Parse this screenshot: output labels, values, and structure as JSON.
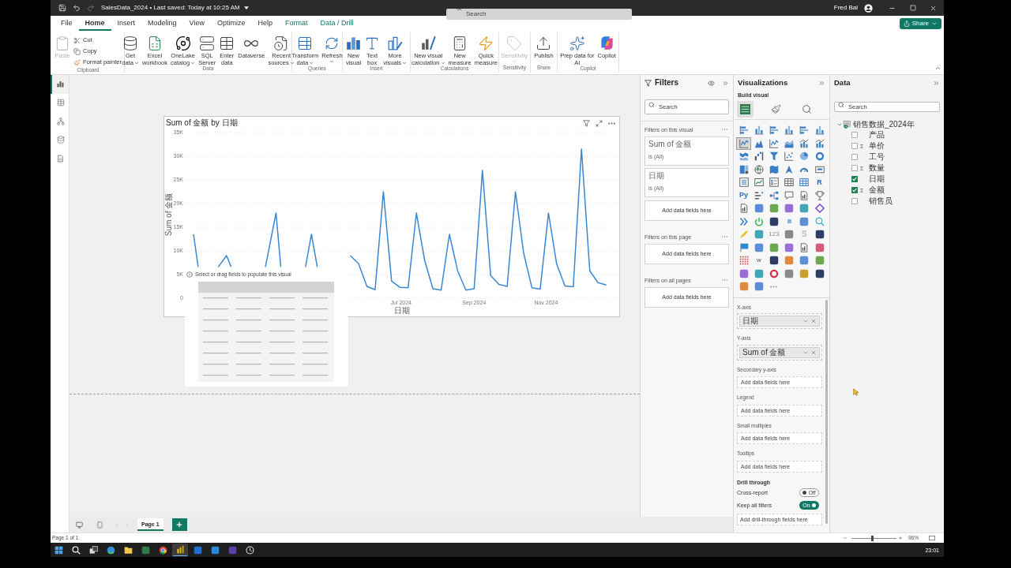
{
  "title_bar": {
    "document_title": "SalesData_2024 • Last saved: Today at 10:25 AM",
    "search": {
      "placeholder": "Search"
    },
    "user_name": "Fred Bai"
  },
  "ribbon_tabs": [
    {
      "label": "File",
      "selected": false,
      "contextual": false
    },
    {
      "label": "Home",
      "selected": true,
      "contextual": false
    },
    {
      "label": "Insert",
      "selected": false,
      "contextual": false
    },
    {
      "label": "Modeling",
      "selected": false,
      "contextual": false
    },
    {
      "label": "View",
      "selected": false,
      "contextual": false
    },
    {
      "label": "Optimize",
      "selected": false,
      "contextual": false
    },
    {
      "label": "Help",
      "selected": false,
      "contextual": false
    },
    {
      "label": "Format",
      "selected": false,
      "contextual": true
    },
    {
      "label": "Data / Drill",
      "selected": false,
      "contextual": true
    }
  ],
  "share_button": {
    "label": "Share"
  },
  "ribbon_groups": [
    {
      "label": "Clipboard",
      "buttons": [
        {
          "kind": "large",
          "lines": [
            "Paste"
          ],
          "dropdown": false,
          "disabled": true
        },
        {
          "kind": "small",
          "lines": [
            "Cut"
          ],
          "dropdown": false,
          "disabled": false
        },
        {
          "kind": "small",
          "lines": [
            "Copy"
          ],
          "dropdown": false,
          "disabled": false
        },
        {
          "kind": "small",
          "lines": [
            "Format painter"
          ],
          "dropdown": false,
          "disabled": false
        }
      ]
    },
    {
      "label": "Data",
      "buttons": [
        {
          "kind": "large",
          "lines": [
            "Get",
            "data"
          ],
          "dropdown": true,
          "disabled": false
        },
        {
          "kind": "large",
          "lines": [
            "Excel",
            "workbook"
          ],
          "dropdown": false,
          "disabled": false
        },
        {
          "kind": "large",
          "lines": [
            "OneLake",
            "catalog"
          ],
          "dropdown": true,
          "disabled": false
        },
        {
          "kind": "large",
          "lines": [
            "SQL",
            "Server"
          ],
          "dropdown": false,
          "disabled": false
        },
        {
          "kind": "large",
          "lines": [
            "Enter",
            "data"
          ],
          "dropdown": false,
          "disabled": false
        },
        {
          "kind": "large",
          "lines": [
            "Dataverse"
          ],
          "dropdown": false,
          "disabled": false
        },
        {
          "kind": "large",
          "lines": [
            "Recent",
            "sources"
          ],
          "dropdown": true,
          "disabled": false
        }
      ]
    },
    {
      "label": "Queries",
      "buttons": [
        {
          "kind": "large",
          "lines": [
            "Transform",
            "data"
          ],
          "dropdown": true,
          "disabled": false
        },
        {
          "kind": "large",
          "lines": [
            "Refresh"
          ],
          "dropdown": true,
          "disabled": false
        }
      ]
    },
    {
      "label": "Insert",
      "buttons": [
        {
          "kind": "large",
          "lines": [
            "New",
            "visual"
          ],
          "dropdown": false,
          "disabled": false
        },
        {
          "kind": "large",
          "lines": [
            "Text",
            "box"
          ],
          "dropdown": false,
          "disabled": false
        },
        {
          "kind": "large",
          "lines": [
            "More",
            "visuals"
          ],
          "dropdown": true,
          "disabled": false
        }
      ]
    },
    {
      "label": "Calculations",
      "buttons": [
        {
          "kind": "large",
          "lines": [
            "New visual",
            "calculation"
          ],
          "dropdown": true,
          "disabled": false
        },
        {
          "kind": "large",
          "lines": [
            "New",
            "measure"
          ],
          "dropdown": false,
          "disabled": false
        },
        {
          "kind": "large",
          "lines": [
            "Quick",
            "measure"
          ],
          "dropdown": false,
          "disabled": false
        }
      ]
    },
    {
      "label": "Sensitivity",
      "buttons": [
        {
          "kind": "large",
          "lines": [
            "Sensitivity"
          ],
          "dropdown": true,
          "disabled": true
        }
      ]
    },
    {
      "label": "Share",
      "buttons": [
        {
          "kind": "large",
          "lines": [
            "Publish"
          ],
          "dropdown": false,
          "disabled": false
        }
      ]
    },
    {
      "label": "Copilot",
      "buttons": [
        {
          "kind": "large",
          "lines": [
            "Prep data for",
            "AI"
          ],
          "dropdown": false,
          "disabled": false
        },
        {
          "kind": "large",
          "lines": [
            "Copilot"
          ],
          "dropdown": false,
          "disabled": false
        }
      ]
    }
  ],
  "view_switcher": [
    {
      "selected": true
    },
    {
      "selected": false
    },
    {
      "selected": false
    },
    {
      "selected": false
    },
    {
      "selected": false
    }
  ],
  "report_canvas": {
    "visual": {
      "chart_data": [
        {
          "type": "line",
          "title": "Sum of 金额 by 日期",
          "xlabel": "日期",
          "ylabel": "Sum of 金额",
          "color": "#3a87d4",
          "grid": true,
          "xlim": [
            "2024-01-01",
            "2024-12-31"
          ],
          "ylim": [
            0,
            35000
          ],
          "xticks": [
            {
              "value": "2024-07-01",
              "label": "Jul 2024"
            },
            {
              "value": "2024-09-01",
              "label": "Sep 2024"
            },
            {
              "value": "2024-11-01",
              "label": "Nov 2024"
            }
          ],
          "yticks": [
            {
              "value": 0,
              "label": "0"
            },
            {
              "value": 5000,
              "label": "5K"
            },
            {
              "value": 10000,
              "label": "10K"
            },
            {
              "value": 15000,
              "label": "15K"
            },
            {
              "value": 20000,
              "label": "20K"
            },
            {
              "value": 25000,
              "label": "25K"
            },
            {
              "value": 30000,
              "label": "30K"
            },
            {
              "value": 35000,
              "label": "35K"
            }
          ],
          "x": [
            "2024-01-07",
            "2024-01-11",
            "2024-01-21",
            "2024-01-28",
            "2024-02-04",
            "2024-02-08",
            "2024-02-25",
            "2024-03-08",
            "2024-03-17",
            "2024-03-21",
            "2024-04-01",
            "2024-04-11",
            "2024-04-16",
            "2024-04-21",
            "2024-05-05",
            "2024-05-19",
            "2024-05-26",
            "2024-06-02",
            "2024-06-09",
            "2024-06-16",
            "2024-06-23",
            "2024-06-30",
            "2024-07-07",
            "2024-07-14",
            "2024-07-21",
            "2024-07-28",
            "2024-08-04",
            "2024-08-11",
            "2024-08-18",
            "2024-08-25",
            "2024-09-01",
            "2024-09-08",
            "2024-09-15",
            "2024-09-22",
            "2024-09-29",
            "2024-10-06",
            "2024-10-13",
            "2024-10-20",
            "2024-10-27",
            "2024-11-03",
            "2024-11-10",
            "2024-11-17",
            "2024-11-24",
            "2024-12-01",
            "2024-12-08",
            "2024-12-15",
            "2024-12-22"
          ],
          "values": [
            13500,
            6600,
            null,
            6600,
            9000,
            6600,
            null,
            6600,
            18000,
            6600,
            null,
            6600,
            13500,
            6600,
            null,
            9000,
            7300,
            2500,
            1800,
            22500,
            3600,
            2300,
            2200,
            18000,
            8000,
            2000,
            1700,
            13500,
            5800,
            1700,
            2000,
            27000,
            4800,
            2900,
            2500,
            22500,
            9500,
            2200,
            1900,
            18000,
            7200,
            2600,
            2400,
            31500,
            5800,
            3300,
            2800
          ]
        }
      ]
    },
    "placeholder_visual": {
      "message": "Select or drag fields to populate this visual"
    }
  },
  "page_tabs": [
    {
      "label": "Page 1",
      "selected": true
    }
  ],
  "filters_pane": {
    "title": "Filters",
    "search": {
      "placeholder": "Search"
    },
    "sections": [
      {
        "title": "Filters on this visual",
        "cards": [
          {
            "kind": "filter",
            "field": "Sum of 金额",
            "condition": "is (All)"
          },
          {
            "kind": "filter",
            "field": "日期",
            "condition": "is (All)"
          },
          {
            "kind": "drop",
            "placeholder": "Add data fields here"
          }
        ]
      },
      {
        "title": "Filters on this page",
        "cards": [
          {
            "kind": "drop",
            "placeholder": "Add data fields here"
          }
        ]
      },
      {
        "title": "Filters on all pages",
        "cards": [
          {
            "kind": "drop",
            "placeholder": "Add data fields here"
          }
        ]
      }
    ]
  },
  "visualizations_pane": {
    "title": "Visualizations",
    "subtitle": "Build visual",
    "build_tabs": [
      {
        "selected": true
      },
      {
        "selected": false
      },
      {
        "selected": false
      }
    ],
    "gallery": [
      {
        "selected": false
      },
      {
        "selected": false
      },
      {
        "selected": false
      },
      {
        "selected": false
      },
      {
        "selected": false
      },
      {
        "selected": false
      },
      {
        "selected": true
      },
      {
        "selected": false
      },
      {
        "selected": false
      },
      {
        "selected": false
      },
      {
        "selected": false
      },
      {
        "selected": false
      },
      {
        "selected": false
      },
      {
        "selected": false
      },
      {
        "selected": false
      },
      {
        "selected": false
      },
      {
        "selected": false
      },
      {
        "selected": false
      },
      {
        "selected": false
      },
      {
        "selected": false
      },
      {
        "selected": false
      },
      {
        "selected": false
      },
      {
        "selected": false
      },
      {
        "selected": false
      },
      {
        "selected": false
      },
      {
        "selected": false
      },
      {
        "selected": false
      },
      {
        "selected": false
      },
      {
        "selected": false
      },
      {
        "label": "R",
        "selected": false
      },
      {
        "label": "Py",
        "selected": false
      },
      {
        "selected": false
      },
      {
        "selected": false
      },
      {
        "selected": false
      },
      {
        "selected": false
      },
      {
        "selected": false
      },
      {
        "selected": false
      },
      {
        "selected": false
      },
      {
        "selected": false
      },
      {
        "selected": false
      },
      {
        "selected": false
      },
      {
        "selected": false
      },
      {
        "selected": false
      },
      {
        "selected": false
      },
      {
        "selected": false
      },
      {
        "selected": false
      },
      {
        "selected": false
      },
      {
        "selected": false
      },
      {
        "selected": false
      },
      {
        "selected": false
      },
      {
        "label": "123",
        "selected": false
      },
      {
        "selected": false
      },
      {
        "label": "S",
        "selected": false
      },
      {
        "selected": false
      },
      {
        "selected": false
      },
      {
        "selected": false
      },
      {
        "selected": false
      },
      {
        "selected": false
      },
      {
        "selected": false
      },
      {
        "selected": false
      },
      {
        "selected": false
      },
      {
        "label": "w",
        "selected": false
      },
      {
        "selected": false
      },
      {
        "selected": false
      },
      {
        "selected": false
      },
      {
        "selected": false
      },
      {
        "selected": false
      },
      {
        "selected": false
      },
      {
        "selected": false
      },
      {
        "selected": false
      },
      {
        "selected": false
      },
      {
        "selected": false
      },
      {
        "selected": false
      },
      {
        "selected": false
      }
    ],
    "wells": [
      {
        "kind": "field",
        "label": "X-axis",
        "field": "日期"
      },
      {
        "kind": "field",
        "label": "Y-axis",
        "field": "Sum of 金额"
      },
      {
        "kind": "drop",
        "label": "Secondary y-axis",
        "placeholder": "Add data fields here"
      },
      {
        "kind": "drop",
        "label": "Legend",
        "placeholder": "Add data fields here"
      },
      {
        "kind": "drop",
        "label": "Small multiples",
        "placeholder": "Add data fields here"
      },
      {
        "kind": "drop",
        "label": "Tooltips",
        "placeholder": "Add data fields here"
      }
    ],
    "drill_through": {
      "title": "Drill through",
      "toggles": [
        {
          "label": "Cross-report",
          "on": false,
          "state_text": "Off"
        },
        {
          "label": "Keep all filters",
          "on": true,
          "state_text": "On"
        }
      ],
      "placeholder": "Add drill-through fields here"
    }
  },
  "data_pane": {
    "title": "Data",
    "search": {
      "placeholder": "Search"
    },
    "tables": [
      {
        "name": "销售数据_2024年",
        "expanded": true,
        "children": [
          {
            "name": "产品",
            "checked": false
          },
          {
            "name": "单价",
            "checked": false,
            "sum_mark": "Σ"
          },
          {
            "name": "工号",
            "checked": false
          },
          {
            "name": "数量",
            "checked": false,
            "sum_mark": "Σ"
          },
          {
            "name": "日期",
            "checked": true
          },
          {
            "name": "金额",
            "checked": true,
            "sum_mark": "Σ"
          },
          {
            "name": "销售员",
            "checked": false
          }
        ]
      }
    ]
  },
  "status_bar": {
    "page_info": "Page 1 of 1",
    "zoom": {
      "level": 0.46,
      "reading": "96%"
    }
  },
  "taskbar": {
    "apps": [
      {
        "selected": false
      },
      {
        "selected": false
      },
      {
        "selected": false
      },
      {
        "selected": false
      },
      {
        "selected": false
      },
      {
        "selected": false
      },
      {
        "selected": false
      },
      {
        "selected": true
      },
      {
        "selected": false
      },
      {
        "selected": false
      },
      {
        "selected": false
      },
      {
        "selected": false
      }
    ],
    "clock": "23:01"
  }
}
